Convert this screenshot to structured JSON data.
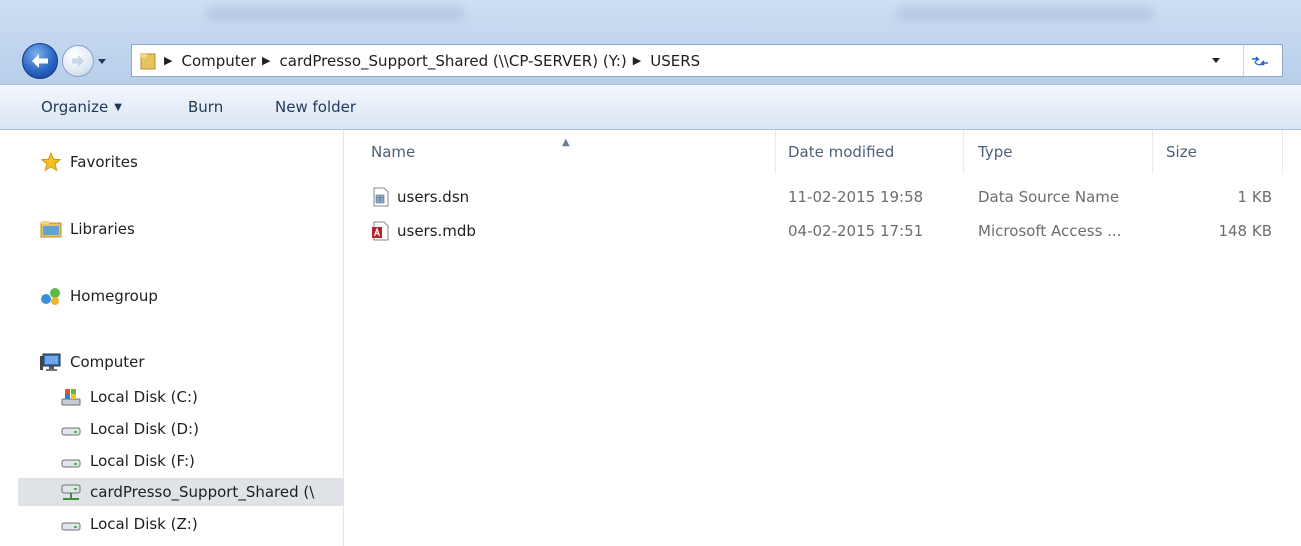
{
  "address_bar": {
    "crumbs": [
      "Computer",
      "cardPresso_Support_Shared (\\\\CP-SERVER) (Y:)",
      "USERS"
    ]
  },
  "toolbar": {
    "organize": "Organize",
    "burn": "Burn",
    "new_folder": "New folder"
  },
  "sidebar": {
    "favorites": "Favorites",
    "libraries": "Libraries",
    "homegroup": "Homegroup",
    "computer": "Computer",
    "drives": [
      {
        "label": "Local Disk (C:)",
        "icon": "system-drive-icon"
      },
      {
        "label": "Local Disk (D:)",
        "icon": "hard-drive-icon"
      },
      {
        "label": "Local Disk (F:)",
        "icon": "hard-drive-icon"
      },
      {
        "label": "cardPresso_Support_Shared (\\",
        "icon": "network-drive-icon",
        "selected": true
      },
      {
        "label": "Local Disk (Z:)",
        "icon": "hard-drive-icon"
      }
    ]
  },
  "columns": {
    "name": "Name",
    "date": "Date modified",
    "type": "Type",
    "size": "Size"
  },
  "files": [
    {
      "name": "users.dsn",
      "date": "11-02-2015 19:58",
      "type": "Data Source Name",
      "size": "1 KB",
      "icon": "dsn-file-icon"
    },
    {
      "name": "users.mdb",
      "date": "04-02-2015 17:51",
      "type": "Microsoft Access ...",
      "size": "148 KB",
      "icon": "access-file-icon"
    }
  ],
  "colors": {
    "address_bar_bg": "#c2d7ef",
    "toolbar_bg": "#e6eef8",
    "selected_nav_bg": "#dfe3e8",
    "header_text": "#4c607a"
  }
}
